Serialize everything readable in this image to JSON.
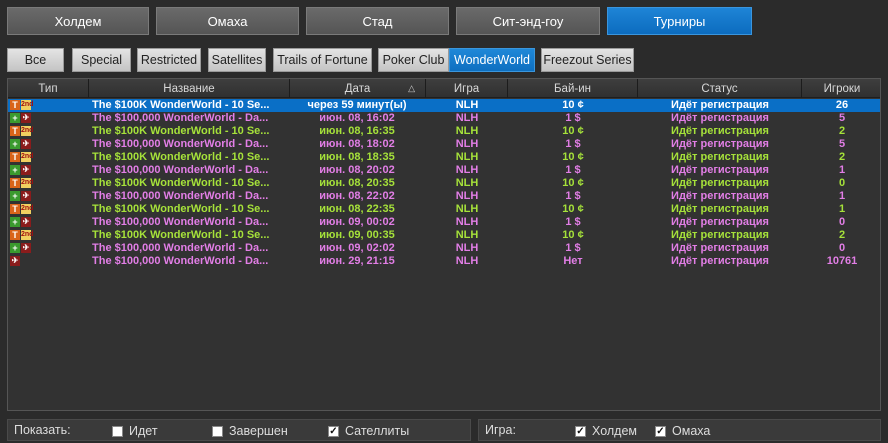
{
  "main_tabs": [
    {
      "label": "Холдем",
      "active": false
    },
    {
      "label": "Омаха",
      "active": false
    },
    {
      "label": "Стад",
      "active": false
    },
    {
      "label": "Сит-энд-гоу",
      "active": false
    },
    {
      "label": "Турниры",
      "active": true
    }
  ],
  "sub_tabs": [
    {
      "label": "Все",
      "active": false
    },
    {
      "label": "Special",
      "active": false
    },
    {
      "label": "Restricted",
      "active": false
    },
    {
      "label": "Satellites",
      "active": false
    },
    {
      "label": "Trails of Fortune",
      "active": false
    },
    {
      "label": "Poker Club",
      "active": false
    },
    {
      "label": "WonderWorld",
      "active": true
    },
    {
      "label": "Freezout Series",
      "active": false
    }
  ],
  "columns": [
    "Тип",
    "Название",
    "Дата",
    "Игра",
    "Бай-ин",
    "Статус",
    "Игроки"
  ],
  "sort_indicator": "△",
  "rows": [
    {
      "type": [
        "T",
        "2nd"
      ],
      "name": "The $100K WonderWorld - 10 Se...",
      "date": "через 59 минут(ы)",
      "game": "NLH",
      "buyin": "10 ¢",
      "status": "Идёт регистрация",
      "players": "26",
      "color": "white",
      "selected": true
    },
    {
      "type": [
        "+",
        "plane"
      ],
      "name": "The $100,000 WonderWorld - Da...",
      "date": "июн. 08, 16:02",
      "game": "NLH",
      "buyin": "1 $",
      "status": "Идёт регистрация",
      "players": "5",
      "color": "pink"
    },
    {
      "type": [
        "T",
        "2nd"
      ],
      "name": "The $100K WonderWorld - 10 Se...",
      "date": "июн. 08, 16:35",
      "game": "NLH",
      "buyin": "10 ¢",
      "status": "Идёт регистрация",
      "players": "2",
      "color": "green"
    },
    {
      "type": [
        "+",
        "plane"
      ],
      "name": "The $100,000 WonderWorld - Da...",
      "date": "июн. 08, 18:02",
      "game": "NLH",
      "buyin": "1 $",
      "status": "Идёт регистрация",
      "players": "5",
      "color": "pink"
    },
    {
      "type": [
        "T",
        "2nd"
      ],
      "name": "The $100K WonderWorld - 10 Se...",
      "date": "июн. 08, 18:35",
      "game": "NLH",
      "buyin": "10 ¢",
      "status": "Идёт регистрация",
      "players": "2",
      "color": "green"
    },
    {
      "type": [
        "+",
        "plane"
      ],
      "name": "The $100,000 WonderWorld - Da...",
      "date": "июн. 08, 20:02",
      "game": "NLH",
      "buyin": "1 $",
      "status": "Идёт регистрация",
      "players": "1",
      "color": "pink"
    },
    {
      "type": [
        "T",
        "2nd"
      ],
      "name": "The $100K WonderWorld - 10 Se...",
      "date": "июн. 08, 20:35",
      "game": "NLH",
      "buyin": "10 ¢",
      "status": "Идёт регистрация",
      "players": "0",
      "color": "green"
    },
    {
      "type": [
        "+",
        "plane"
      ],
      "name": "The $100,000 WonderWorld - Da...",
      "date": "июн. 08, 22:02",
      "game": "NLH",
      "buyin": "1 $",
      "status": "Идёт регистрация",
      "players": "1",
      "color": "pink"
    },
    {
      "type": [
        "T",
        "2nd"
      ],
      "name": "The $100K WonderWorld - 10 Se...",
      "date": "июн. 08, 22:35",
      "game": "NLH",
      "buyin": "10 ¢",
      "status": "Идёт регистрация",
      "players": "1",
      "color": "green"
    },
    {
      "type": [
        "+",
        "plane"
      ],
      "name": "The $100,000 WonderWorld - Da...",
      "date": "июн. 09, 00:02",
      "game": "NLH",
      "buyin": "1 $",
      "status": "Идёт регистрация",
      "players": "0",
      "color": "pink"
    },
    {
      "type": [
        "T",
        "2nd"
      ],
      "name": "The $100K WonderWorld - 10 Se...",
      "date": "июн. 09, 00:35",
      "game": "NLH",
      "buyin": "10 ¢",
      "status": "Идёт регистрация",
      "players": "2",
      "color": "green"
    },
    {
      "type": [
        "+",
        "plane"
      ],
      "name": "The $100,000 WonderWorld - Da...",
      "date": "июн. 09, 02:02",
      "game": "NLH",
      "buyin": "1 $",
      "status": "Идёт регистрация",
      "players": "0",
      "color": "pink"
    },
    {
      "type": [
        "plane"
      ],
      "name": "The $100,000 WonderWorld - Da...",
      "date": "июн. 29, 21:15",
      "game": "NLH",
      "buyin": "Нет",
      "status": "Идёт регистрация",
      "players": "10761",
      "color": "pink"
    }
  ],
  "row_colors": {
    "white": "#ffffff",
    "pink": "#e27ee6",
    "green": "#a6e23a"
  },
  "show_panel": {
    "label": "Показать:",
    "options": [
      {
        "label": "Идет",
        "checked": false
      },
      {
        "label": "Завершен",
        "checked": false
      },
      {
        "label": "Сателлиты",
        "checked": true
      }
    ]
  },
  "game_panel": {
    "label": "Игра:",
    "options": [
      {
        "label": "Холдем",
        "checked": true
      },
      {
        "label": "Омаха",
        "checked": true
      }
    ]
  }
}
